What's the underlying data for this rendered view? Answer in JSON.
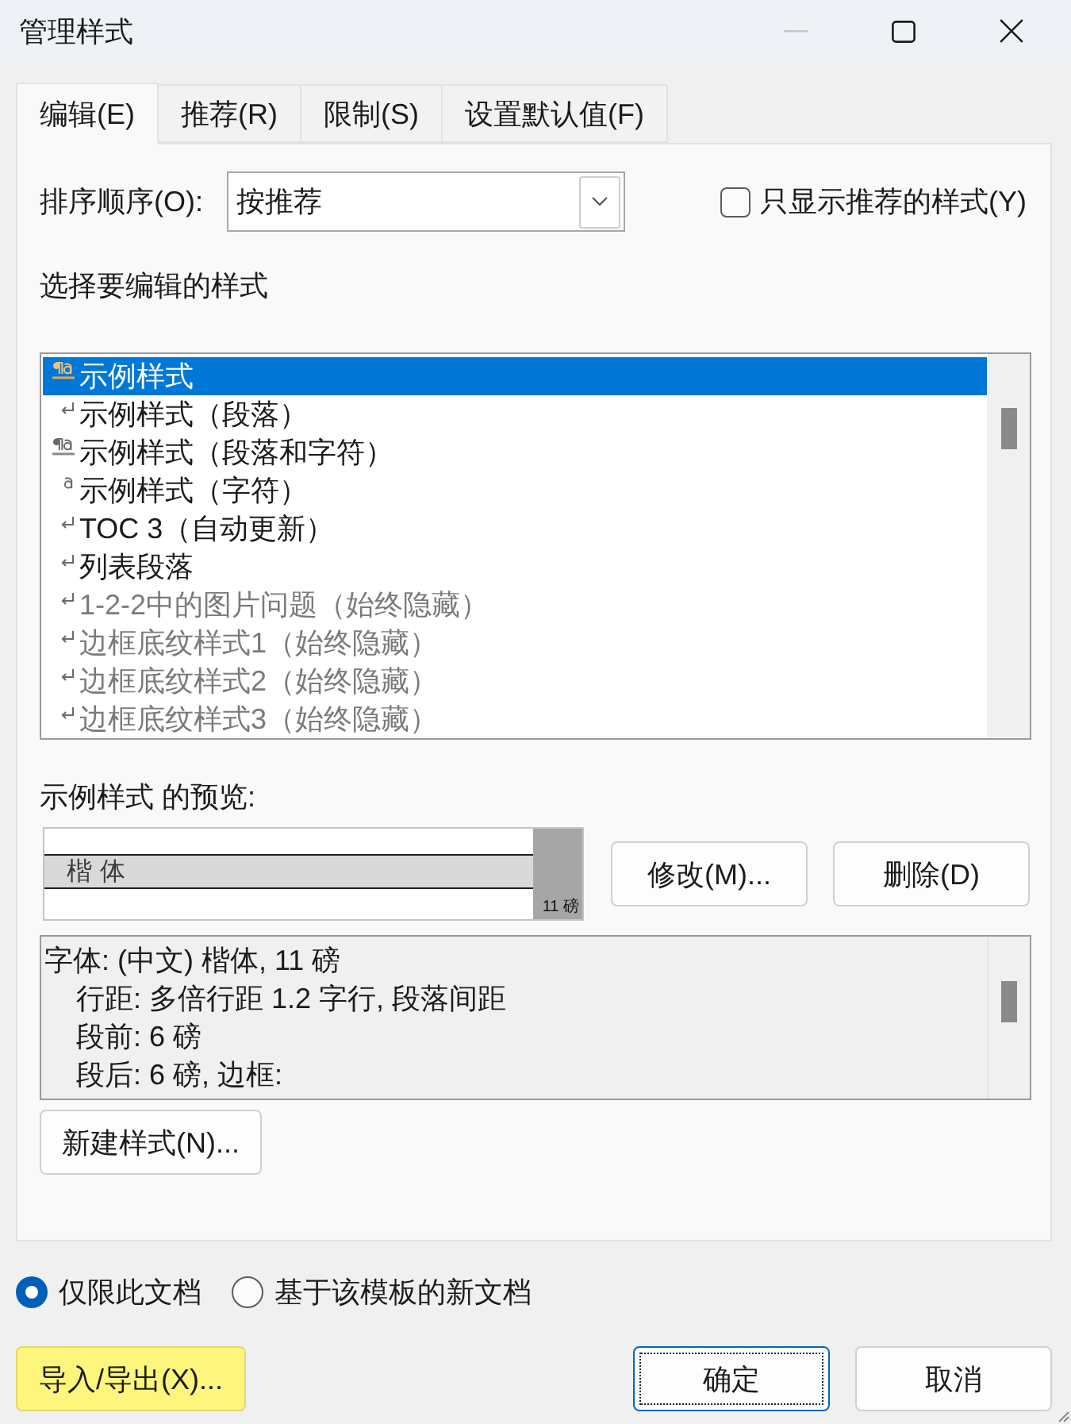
{
  "window": {
    "title": "管理样式",
    "minimize_disabled": true
  },
  "tabs": [
    {
      "label": "编辑(E)",
      "selected": true
    },
    {
      "label": "推荐(R)",
      "selected": false
    },
    {
      "label": "限制(S)",
      "selected": false
    },
    {
      "label": "设置默认值(F)",
      "selected": false
    }
  ],
  "sort_order": {
    "label": "排序顺序(O):",
    "value": "按推荐"
  },
  "recommended_only": {
    "label": "只显示推荐的样式(Y)",
    "checked": false
  },
  "styles": {
    "label": "选择要编辑的样式",
    "items": [
      {
        "kind": "linked",
        "name": "示例样式",
        "selected": true,
        "greyed": false
      },
      {
        "kind": "paragraph",
        "name": "示例样式（段落）",
        "selected": false,
        "greyed": false
      },
      {
        "kind": "linked",
        "name": "示例样式（段落和字符）",
        "selected": false,
        "greyed": false
      },
      {
        "kind": "character",
        "name": "示例样式（字符）",
        "selected": false,
        "greyed": false
      },
      {
        "kind": "paragraph",
        "name": "TOC 3（自动更新）",
        "selected": false,
        "greyed": false
      },
      {
        "kind": "paragraph",
        "name": "列表段落",
        "selected": false,
        "greyed": false
      },
      {
        "kind": "paragraph",
        "name": "1-2-2中的图片问题（始终隐藏）",
        "selected": false,
        "greyed": true
      },
      {
        "kind": "paragraph",
        "name": "边框底纹样式1（始终隐藏）",
        "selected": false,
        "greyed": true
      },
      {
        "kind": "paragraph",
        "name": "边框底纹样式2（始终隐藏）",
        "selected": false,
        "greyed": true
      },
      {
        "kind": "paragraph",
        "name": "边框底纹样式3（始终隐藏）",
        "selected": false,
        "greyed": true
      }
    ]
  },
  "preview": {
    "label": "示例样式 的预览:",
    "sample": "楷体",
    "size": "11 磅"
  },
  "modify_button": {
    "label": "修改(M)..."
  },
  "delete_button": {
    "label": "删除(D)"
  },
  "description": {
    "lines": [
      "字体: (中文) 楷体, 11 磅",
      "行距: 多倍行距 1.2 字行, 段落间距",
      "段前: 6 磅",
      "段后: 6 磅, 边框:"
    ]
  },
  "new_style_button": {
    "label": "新建样式(N)..."
  },
  "scope": [
    {
      "label": "仅限此文档",
      "selected": true
    },
    {
      "label": "基于该模板的新文档",
      "selected": false
    }
  ],
  "import_export_button": {
    "label": "导入/导出(X)...",
    "highlighted": true
  },
  "dialog_buttons": [
    {
      "label": "确定",
      "default": true
    },
    {
      "label": "取消",
      "default": false
    }
  ]
}
